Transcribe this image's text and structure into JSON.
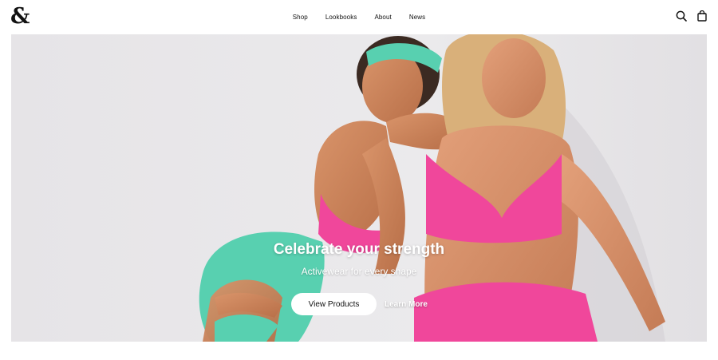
{
  "header": {
    "logo": "&",
    "nav": [
      {
        "label": "Shop"
      },
      {
        "label": "Lookbooks"
      },
      {
        "label": "About"
      },
      {
        "label": "News"
      }
    ]
  },
  "hero": {
    "headline": "Celebrate your strength",
    "subheadline": "Activewear for every shape",
    "primary_cta": "View Products",
    "secondary_cta": "Learn More"
  },
  "icons": [
    "search-icon",
    "shopping-bag-icon"
  ],
  "colors": {
    "hero_background": "#e7e6e8",
    "pink": "#f0479b",
    "mint": "#58d0b0",
    "text": "#111111"
  }
}
